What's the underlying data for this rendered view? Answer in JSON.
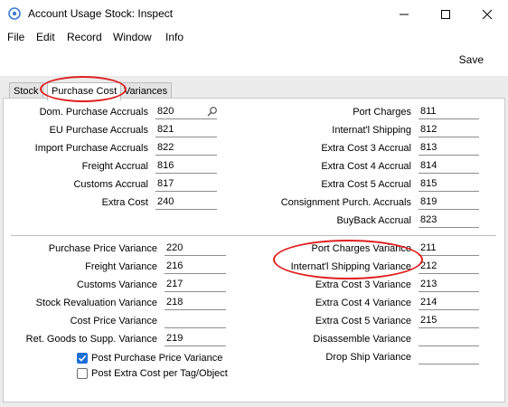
{
  "window": {
    "title": "Account Usage Stock: Inspect"
  },
  "menu": {
    "items": [
      "File",
      "Edit",
      "Record",
      "Window",
      "Info"
    ]
  },
  "toolbar": {
    "save_label": "Save"
  },
  "tabs": [
    {
      "label": "Stock"
    },
    {
      "label": "Purchase Cost",
      "active": true
    },
    {
      "label": "Variances"
    }
  ],
  "accruals_left": [
    {
      "label": "Dom. Purchase Accruals",
      "value": "820"
    },
    {
      "label": "EU Purchase Accruals",
      "value": "821"
    },
    {
      "label": "Import Purchase Accruals",
      "value": "822"
    },
    {
      "label": "Freight Accrual",
      "value": "816"
    },
    {
      "label": "Customs Accrual",
      "value": "817"
    },
    {
      "label": "Extra Cost",
      "value": "240"
    }
  ],
  "accruals_right": [
    {
      "label": "Port Charges",
      "value": "811"
    },
    {
      "label": "Internat'l Shipping",
      "value": "812"
    },
    {
      "label": "Extra Cost 3 Accrual",
      "value": "813"
    },
    {
      "label": "Extra Cost 4 Accrual",
      "value": "814"
    },
    {
      "label": "Extra Cost 5 Accrual",
      "value": "815"
    },
    {
      "label": "Consignment Purch. Accruals",
      "value": "819"
    },
    {
      "label": "BuyBack Accrual",
      "value": "823"
    }
  ],
  "variances_left": [
    {
      "label": "Purchase Price Variance",
      "value": "220"
    },
    {
      "label": "Freight Variance",
      "value": "216"
    },
    {
      "label": "Customs Variance",
      "value": "217"
    },
    {
      "label": "Stock Revaluation Variance",
      "value": "218"
    },
    {
      "label": "Cost Price Variance",
      "value": ""
    },
    {
      "label": "Ret. Goods to Supp. Variance",
      "value": "219"
    }
  ],
  "variances_right": [
    {
      "label": "Port Charges Variance",
      "value": "211"
    },
    {
      "label": "Internat'l Shipping Variance",
      "value": "212"
    },
    {
      "label": "Extra Cost 3 Variance",
      "value": "213"
    },
    {
      "label": "Extra Cost 4 Variance",
      "value": "214"
    },
    {
      "label": "Extra Cost 5 Variance",
      "value": "215"
    },
    {
      "label": "Disassemble Variance",
      "value": ""
    },
    {
      "label": "Drop Ship Variance",
      "value": ""
    }
  ],
  "checkboxes": [
    {
      "label": "Post Purchase Price Variance",
      "checked": true
    },
    {
      "label": "Post Extra Cost per Tag/Object",
      "checked": false
    }
  ],
  "colors": {
    "highlight_ring": "#e02020",
    "checkbox_checked": "#1d6fd6"
  }
}
